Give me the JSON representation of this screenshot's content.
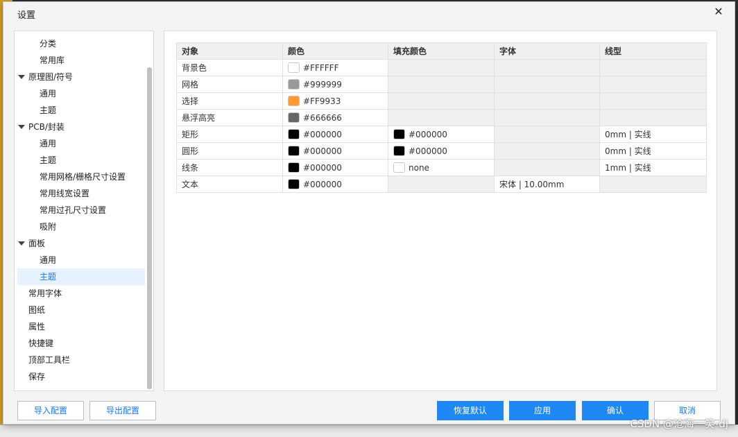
{
  "dialog": {
    "title": "设置",
    "close_glyph": "✕"
  },
  "sidebar": {
    "items": [
      {
        "label": "分类",
        "level": 1
      },
      {
        "label": "常用库",
        "level": 1
      },
      {
        "label": "原理图/符号",
        "level": "parent"
      },
      {
        "label": "通用",
        "level": 1
      },
      {
        "label": "主题",
        "level": 1
      },
      {
        "label": "PCB/封装",
        "level": "parent"
      },
      {
        "label": "通用",
        "level": 1
      },
      {
        "label": "主题",
        "level": 1
      },
      {
        "label": "常用网格/栅格尺寸设置",
        "level": 1
      },
      {
        "label": "常用线宽设置",
        "level": 1
      },
      {
        "label": "常用过孔尺寸设置",
        "level": 1
      },
      {
        "label": "吸附",
        "level": 1
      },
      {
        "label": "面板",
        "level": "parent"
      },
      {
        "label": "通用",
        "level": 1
      },
      {
        "label": "主题",
        "level": 1,
        "active": true
      },
      {
        "label": "常用字体",
        "level": 0
      },
      {
        "label": "图纸",
        "level": 0
      },
      {
        "label": "属性",
        "level": 0
      },
      {
        "label": "快捷键",
        "level": 0
      },
      {
        "label": "顶部工具栏",
        "level": 0
      },
      {
        "label": "保存",
        "level": 0
      }
    ]
  },
  "table": {
    "headers": [
      "对象",
      "颜色",
      "填充颜色",
      "字体",
      "线型"
    ],
    "rows": [
      {
        "object": "背景色",
        "color": "#FFFFFF",
        "fill": "",
        "font": "",
        "line": ""
      },
      {
        "object": "网格",
        "color": "#999999",
        "fill": "",
        "font": "",
        "line": ""
      },
      {
        "object": "选择",
        "color": "#FF9933",
        "fill": "",
        "font": "",
        "line": ""
      },
      {
        "object": "悬浮高亮",
        "color": "#666666",
        "fill": "",
        "font": "",
        "line": ""
      },
      {
        "object": "矩形",
        "color": "#000000",
        "fill": "#000000",
        "font": "",
        "line": "0mm | 实线"
      },
      {
        "object": "圆形",
        "color": "#000000",
        "fill": "#000000",
        "font": "",
        "line": "0mm | 实线"
      },
      {
        "object": "线条",
        "color": "#000000",
        "fill": "none",
        "font": "",
        "line": "1mm | 实线"
      },
      {
        "object": "文本",
        "color": "#000000",
        "fill": "",
        "font": "宋体 | 10.00mm",
        "line": ""
      }
    ]
  },
  "buttons": {
    "import": "导入配置",
    "export": "导出配置",
    "restore": "恢复默认",
    "apply": "应用",
    "confirm": "确认",
    "cancel": "取消"
  },
  "watermark": "CSDN @沧海一笑-dj"
}
